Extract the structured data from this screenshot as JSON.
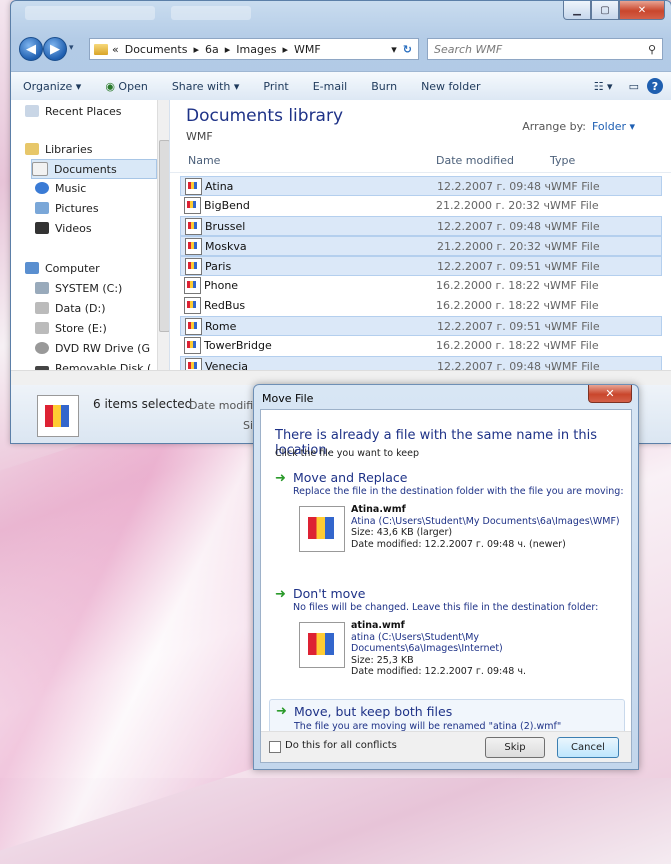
{
  "explorer": {
    "breadcrumb": [
      "«",
      "Documents",
      "▸",
      "6a",
      "▸",
      "Images",
      "▸",
      "WMF"
    ],
    "search_placeholder": "Search WMF",
    "toolbar": [
      "Organize ▾",
      "Open",
      "Share with ▾",
      "Print",
      "E-mail",
      "Burn",
      "New folder"
    ],
    "nav_items": [
      {
        "label": "Recent Places",
        "icon": "recent-places-icon"
      },
      {
        "label": "Libraries",
        "icon": "libraries-icon"
      },
      {
        "label": "Documents",
        "icon": "documents-icon",
        "selected": true
      },
      {
        "label": "Music",
        "icon": "music-icon"
      },
      {
        "label": "Pictures",
        "icon": "pictures-icon"
      },
      {
        "label": "Videos",
        "icon": "videos-icon"
      },
      {
        "label": "Computer",
        "icon": "computer-icon"
      },
      {
        "label": "SYSTEM (C:)",
        "icon": "drive-icon"
      },
      {
        "label": "Data (D:)",
        "icon": "drive-icon"
      },
      {
        "label": "Store (E:)",
        "icon": "drive-icon"
      },
      {
        "label": "DVD RW Drive (G",
        "icon": "dvd-icon"
      },
      {
        "label": "Removable Disk (",
        "icon": "removable-disk-icon"
      }
    ],
    "library_title": "Documents library",
    "library_subtitle": "WMF",
    "arrange_label": "Arrange by:",
    "arrange_value": "Folder ▾",
    "columns": [
      "Name",
      "Date modified",
      "Type"
    ],
    "files": [
      {
        "name": "Atina",
        "date": "12.2.2007 г. 09:48 ч.",
        "type": "WMF File",
        "selected": true
      },
      {
        "name": "BigBend",
        "date": "21.2.2000 г. 20:32 ч.",
        "type": "WMF File",
        "selected": false
      },
      {
        "name": "Brussel",
        "date": "12.2.2007 г. 09:48 ч.",
        "type": "WMF File",
        "selected": true
      },
      {
        "name": "Moskva",
        "date": "21.2.2000 г. 20:32 ч.",
        "type": "WMF File",
        "selected": true
      },
      {
        "name": "Paris",
        "date": "12.2.2007 г. 09:51 ч.",
        "type": "WMF File",
        "selected": true
      },
      {
        "name": "Phone",
        "date": "16.2.2000 г. 18:22 ч.",
        "type": "WMF File",
        "selected": false
      },
      {
        "name": "RedBus",
        "date": "16.2.2000 г. 18:22 ч.",
        "type": "WMF File",
        "selected": false
      },
      {
        "name": "Rome",
        "date": "12.2.2007 г. 09:51 ч.",
        "type": "WMF File",
        "selected": true
      },
      {
        "name": "TowerBridge",
        "date": "16.2.2000 г. 18:22 ч.",
        "type": "WMF File",
        "selected": false
      },
      {
        "name": "Venecia",
        "date": "12.2.2007 г. 09:48 ч.",
        "type": "WMF File",
        "selected": true
      }
    ],
    "status": {
      "selected": "6 items selected",
      "date_label": "Date modifie",
      "size_label": "Siz"
    }
  },
  "dialog": {
    "title": "Move File",
    "heading": "There is already a file with the same name in this location.",
    "instruction": "Click the file you want to keep",
    "replace": {
      "title": "Move and Replace",
      "desc": "Replace the file in the destination folder with the file you are moving:",
      "file_name": "Atina.wmf",
      "file_path": "Atina (C:\\Users\\Student\\My Documents\\6a\\Images\\WMF)",
      "file_size": "Size: 43,6 KB (larger)",
      "file_date": "Date modified: 12.2.2007 г. 09:48 ч. (newer)"
    },
    "dont_move": {
      "title": "Don't move",
      "desc": "No files will be changed. Leave this file in the destination folder:",
      "file_name": "atina.wmf",
      "file_path": "atina (C:\\Users\\Student\\My Documents\\6a\\Images\\Internet)",
      "file_size": "Size: 25,3 KB",
      "file_date": "Date modified: 12.2.2007 г. 09:48 ч."
    },
    "keep_both": {
      "title": "Move, but keep both files",
      "desc": "The file you are moving will be renamed \"atina (2).wmf\""
    },
    "checkbox_label": "Do this for all conflicts",
    "skip_label": "Skip",
    "cancel_label": "Cancel"
  }
}
